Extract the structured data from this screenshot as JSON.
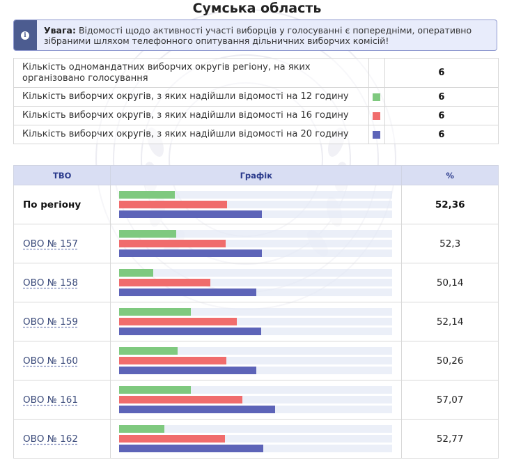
{
  "page": {
    "title": "Сумська область"
  },
  "notice": {
    "icon": "info-icon",
    "label": "Увага:",
    "text": "Відомості щодо активності участі виборців у голосуванні є попередніми, оперативно зібраними шляхом телефонного опитування дільничних виборчих комісій!"
  },
  "summary": [
    {
      "label": "Кількість одномандатних виборчих округів регіону, на яких організовано голосування",
      "swatch": "",
      "value": "6"
    },
    {
      "label": "Кількість виборчих округів, з яких надійшли відомості на 12 годину",
      "swatch": "#7fc97f",
      "value": "6"
    },
    {
      "label": "Кількість виборчих округів, з яких надійшли відомості на 16 годину",
      "swatch": "#f06c6c",
      "value": "6"
    },
    {
      "label": "Кількість виборчих округів, з яких надійшли відомості на 20 годину",
      "swatch": "#5d64b8",
      "value": "6"
    }
  ],
  "colors": {
    "h12": "#7fc97f",
    "h16": "#f06c6c",
    "h20": "#5d64b8",
    "header_bg": "#d9def3",
    "header_text": "#2a3a8c",
    "notice_accent": "#4c5c90"
  },
  "table": {
    "headers": {
      "name": "ТВО",
      "graph": "Графік",
      "pct": "%"
    },
    "bar_scale_max": 100
  },
  "chart_data": {
    "type": "bar",
    "categories": [
      "По регіону",
      "ОВО № 157",
      "ОВО № 158",
      "ОВО № 159",
      "ОВО № 160",
      "ОВО № 161",
      "ОВО № 162"
    ],
    "pct_labels": [
      "52,36",
      "52,3",
      "50,14",
      "52,14",
      "50,26",
      "57,07",
      "52,77"
    ],
    "series": [
      {
        "key": "h12",
        "values": [
          20.3,
          20.8,
          12.5,
          26.2,
          21.4,
          26.3,
          16.6
        ]
      },
      {
        "key": "h16",
        "values": [
          39.5,
          39.0,
          33.4,
          43.0,
          39.3,
          45.2,
          38.7
        ]
      },
      {
        "key": "h20",
        "values": [
          52.36,
          52.3,
          50.14,
          52.14,
          50.26,
          57.07,
          52.77
        ]
      }
    ],
    "ylim": [
      0,
      100
    ]
  }
}
